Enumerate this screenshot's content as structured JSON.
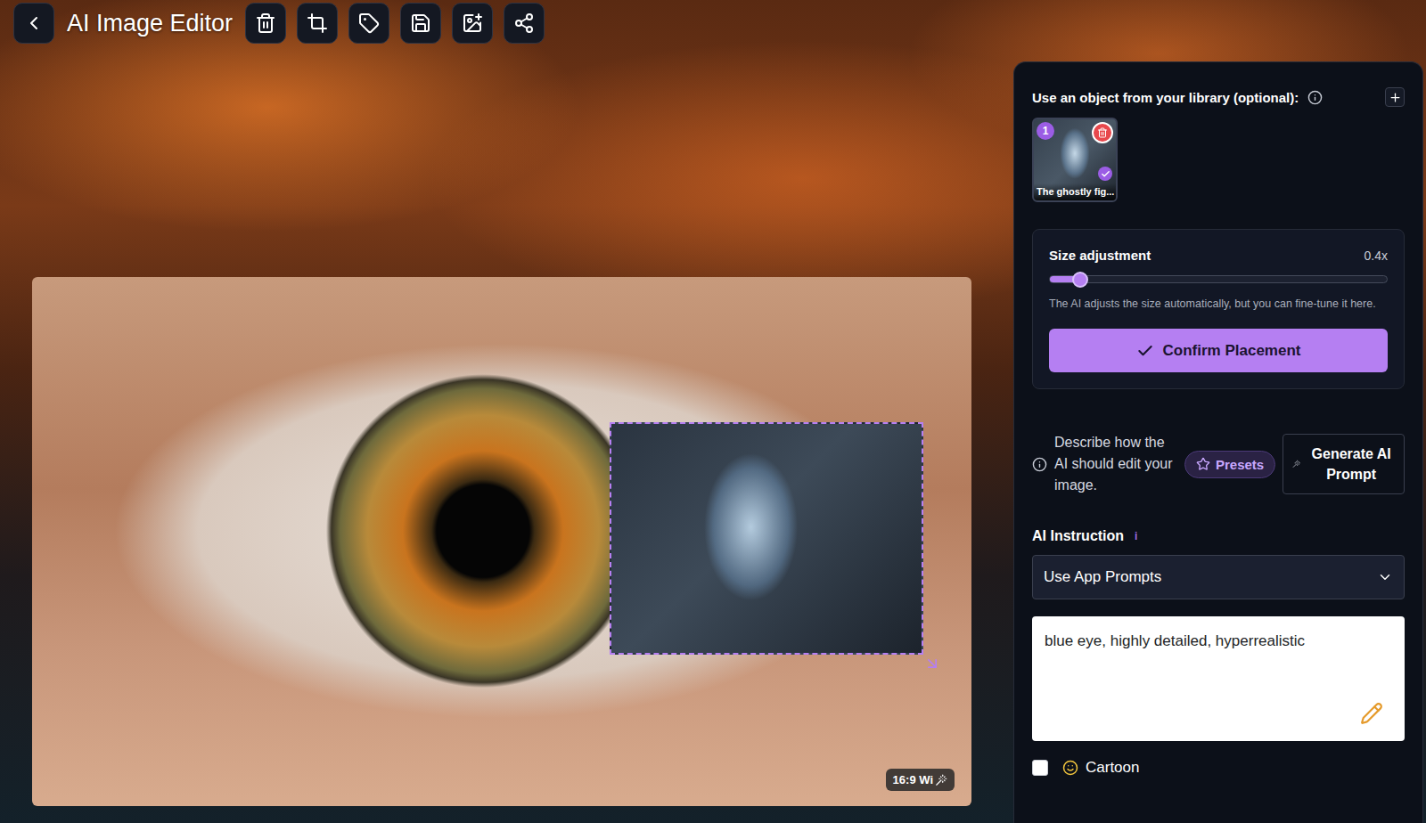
{
  "window": {
    "title": "AI Image Editor"
  },
  "canvas": {
    "badge": "16:9 Wi",
    "placed_object": {
      "selected": true
    }
  },
  "panel": {
    "library": {
      "label": "Use an object from your library (optional):",
      "items": [
        {
          "index": "1",
          "caption": "The ghostly fig...",
          "selected": true
        }
      ]
    },
    "size": {
      "label": "Size adjustment",
      "value": "0.4x",
      "level": 0.09,
      "hint": "The AI adjusts the size automatically, but you can fine-tune it here.",
      "confirm": "Confirm Placement"
    },
    "describe": {
      "text": "Describe how the AI should edit your image.",
      "presets": "Presets",
      "generate": "Generate AI Prompt"
    },
    "instruction": {
      "label": "AI Instruction",
      "info": "i",
      "mode": "Use App Prompts",
      "prompt": "blue eye, highly detailed, hyperrealistic"
    },
    "options": [
      {
        "label": "Cartoon",
        "checked": false
      }
    ]
  }
}
